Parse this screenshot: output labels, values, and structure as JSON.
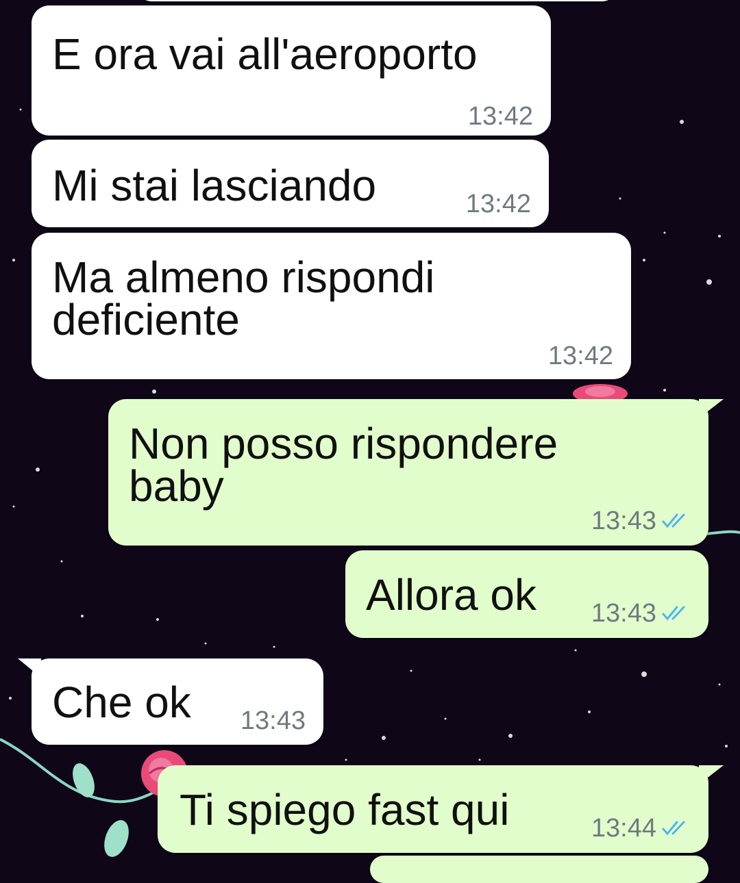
{
  "conversation": {
    "messages": [
      {
        "direction": "incoming",
        "text": "E ora vai all'aeroporto",
        "time": "13:42"
      },
      {
        "direction": "incoming",
        "text": "Mi stai lasciando",
        "time": "13:42"
      },
      {
        "direction": "incoming",
        "text": "Ma almeno rispondi\ndeficiente",
        "time": "13:42"
      },
      {
        "direction": "outgoing",
        "text": "Non posso rispondere\nbaby",
        "time": "13:43",
        "status_icon": "double-check-icon"
      },
      {
        "direction": "outgoing",
        "text": "Allora ok",
        "time": "13:43",
        "status_icon": "double-check-icon"
      },
      {
        "direction": "incoming",
        "text": "Che ok",
        "time": "13:43"
      },
      {
        "direction": "outgoing",
        "text": "Ti spiego fast qui",
        "time": "13:44",
        "status_icon": "double-check-icon"
      }
    ]
  },
  "colors": {
    "background": "#0f0718",
    "incoming_bubble": "#ffffff",
    "outgoing_bubble": "#e2fdcc",
    "text": "#101010",
    "meta_text": "#6f7a80",
    "read_ticks": "#4fb6ec",
    "rose": "#e84b7a",
    "leaf": "#9fe0c8"
  }
}
